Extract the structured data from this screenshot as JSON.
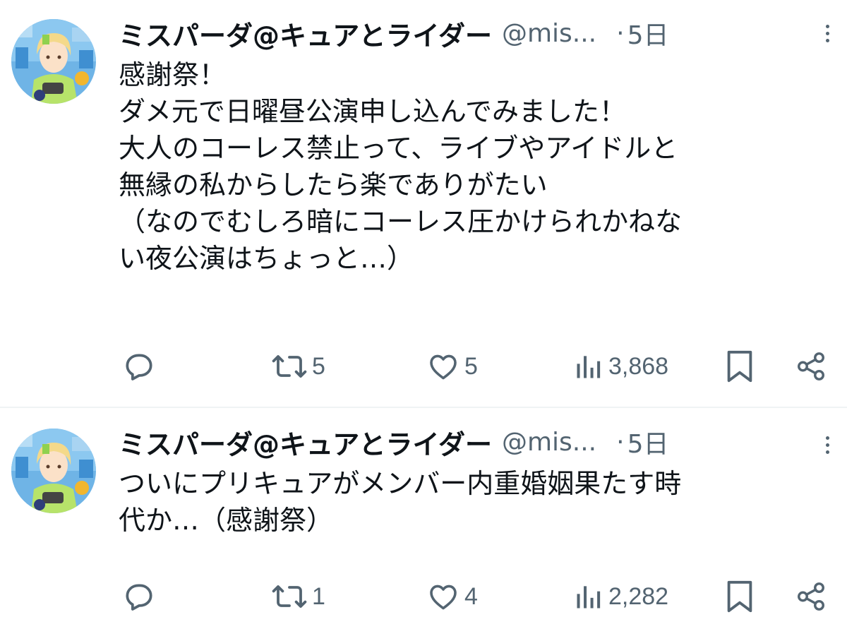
{
  "tweets": [
    {
      "author_name": "ミスパーダ@キュアとライダー",
      "handle": "@mis...",
      "separator": "·",
      "time": "5日",
      "text_lines": [
        "感謝祭！",
        "ダメ元で日曜昼公演申し込んでみました！",
        "大人のコーレス禁止って、ライブやアイドルと",
        "無縁の私からしたら楽でありがたい",
        "（なのでむしろ暗にコーレス圧かけられかねな",
        "い夜公演はちょっと…）"
      ],
      "retweets": "5",
      "likes": "5",
      "views": "3,868"
    },
    {
      "author_name": "ミスパーダ@キュアとライダー",
      "handle": "@mis...",
      "separator": "·",
      "time": "5日",
      "text_lines": [
        "ついにプリキュアがメンバー内重婚姻果たす時",
        "代か…（感謝祭）"
      ],
      "retweets": "1",
      "likes": "4",
      "views": "2,282"
    }
  ],
  "icons": {
    "reply": "speech-bubble-icon",
    "retweet": "retweet-arrows-icon",
    "like": "heart-outline-icon",
    "views": "bar-chart-icon",
    "bookmark": "bookmark-icon",
    "share": "share-nodes-icon",
    "more": "vertical-dots-icon"
  },
  "colors": {
    "text": "#0f1419",
    "secondary": "#536471",
    "divider": "#eff3f4"
  }
}
